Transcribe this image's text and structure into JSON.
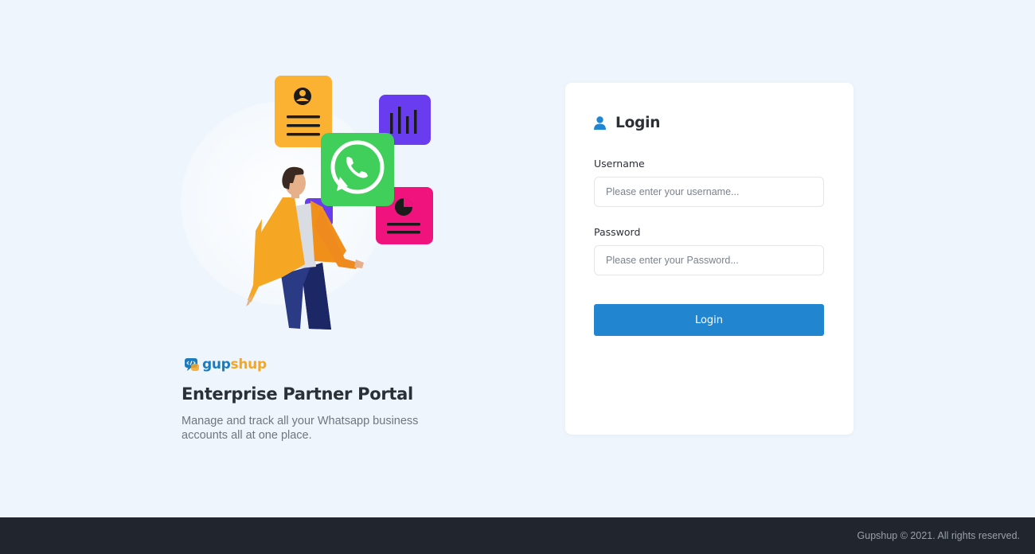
{
  "brand": {
    "name_part1": "gup",
    "name_part2": "shup"
  },
  "hero": {
    "title": "Enterprise Partner Portal",
    "description": "Manage and track all your Whatsapp business accounts all at one place."
  },
  "login": {
    "title": "Login",
    "username_label": "Username",
    "username_placeholder": "Please enter your username...",
    "username_value": "",
    "password_label": "Password",
    "password_placeholder": "Please enter your Password...",
    "password_value": "",
    "button_label": "Login"
  },
  "footer": {
    "copyright": "Gupshup © 2021. All rights reserved."
  },
  "colors": {
    "background": "#eef5fc",
    "primary": "#2185d0",
    "brand_blue": "#1a7bbf",
    "brand_orange": "#f5a623",
    "whatsapp_green": "#3fcf5a",
    "footer_bg": "#21252e"
  },
  "icons": {
    "login_header": "user-icon",
    "brand_logo": "chat-code-icon",
    "illustration": [
      "profile-card-icon",
      "bar-chart-icon",
      "whatsapp-icon",
      "pie-chart-icon",
      "trend-chart-icon"
    ]
  }
}
